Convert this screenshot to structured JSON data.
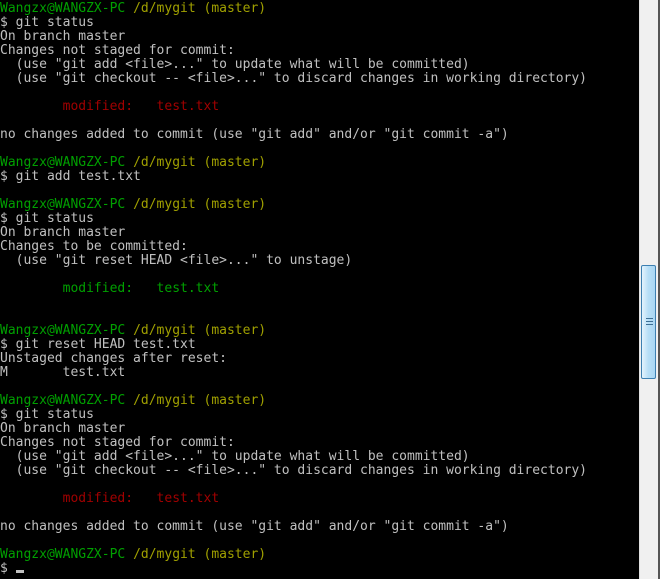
{
  "colors": {
    "text": "#c0c0c0",
    "prompt_user": "#00a000",
    "prompt_path": "#a0a000",
    "unstaged": "#a00000",
    "staged": "#00a000",
    "background": "#000000"
  },
  "terminal": {
    "lines": [
      [
        {
          "t": "Wangzx@WANGZX-PC ",
          "c": "user"
        },
        {
          "t": "/d/mygit (master)",
          "c": "path"
        }
      ],
      [
        {
          "t": "$ git status"
        }
      ],
      [
        {
          "t": "On branch master"
        }
      ],
      [
        {
          "t": "Changes not staged for commit:"
        }
      ],
      [
        {
          "t": "  (use \"git add <file>...\" to update what will be committed)"
        }
      ],
      [
        {
          "t": "  (use \"git checkout -- <file>...\" to discard changes in working directory)"
        }
      ],
      [],
      [
        {
          "t": "        "
        },
        {
          "t": "modified:   test.txt",
          "c": "red"
        }
      ],
      [],
      [
        {
          "t": "no changes added to commit (use \"git add\" and/or \"git commit -a\")"
        }
      ],
      [],
      [
        {
          "t": "Wangzx@WANGZX-PC ",
          "c": "user"
        },
        {
          "t": "/d/mygit (master)",
          "c": "path"
        }
      ],
      [
        {
          "t": "$ git add test.txt"
        }
      ],
      [],
      [
        {
          "t": "Wangzx@WANGZX-PC ",
          "c": "user"
        },
        {
          "t": "/d/mygit (master)",
          "c": "path"
        }
      ],
      [
        {
          "t": "$ git status"
        }
      ],
      [
        {
          "t": "On branch master"
        }
      ],
      [
        {
          "t": "Changes to be committed:"
        }
      ],
      [
        {
          "t": "  (use \"git reset HEAD <file>...\" to unstage)"
        }
      ],
      [],
      [
        {
          "t": "        "
        },
        {
          "t": "modified:   test.txt",
          "c": "green"
        }
      ],
      [],
      [],
      [
        {
          "t": "Wangzx@WANGZX-PC ",
          "c": "user"
        },
        {
          "t": "/d/mygit (master)",
          "c": "path"
        }
      ],
      [
        {
          "t": "$ git reset HEAD test.txt"
        }
      ],
      [
        {
          "t": "Unstaged changes after reset:"
        }
      ],
      [
        {
          "t": "M       test.txt"
        }
      ],
      [],
      [
        {
          "t": "Wangzx@WANGZX-PC ",
          "c": "user"
        },
        {
          "t": "/d/mygit (master)",
          "c": "path"
        }
      ],
      [
        {
          "t": "$ git status"
        }
      ],
      [
        {
          "t": "On branch master"
        }
      ],
      [
        {
          "t": "Changes not staged for commit:"
        }
      ],
      [
        {
          "t": "  (use \"git add <file>...\" to update what will be committed)"
        }
      ],
      [
        {
          "t": "  (use \"git checkout -- <file>...\" to discard changes in working directory)"
        }
      ],
      [],
      [
        {
          "t": "        "
        },
        {
          "t": "modified:   test.txt",
          "c": "red"
        }
      ],
      [],
      [
        {
          "t": "no changes added to commit (use \"git add\" and/or \"git commit -a\")"
        }
      ],
      [],
      [
        {
          "t": "Wangzx@WANGZX-PC ",
          "c": "user"
        },
        {
          "t": "/d/mygit (master)",
          "c": "path"
        }
      ],
      [
        {
          "t": "$ "
        }
      ]
    ],
    "scroll_position_percent": 50
  }
}
